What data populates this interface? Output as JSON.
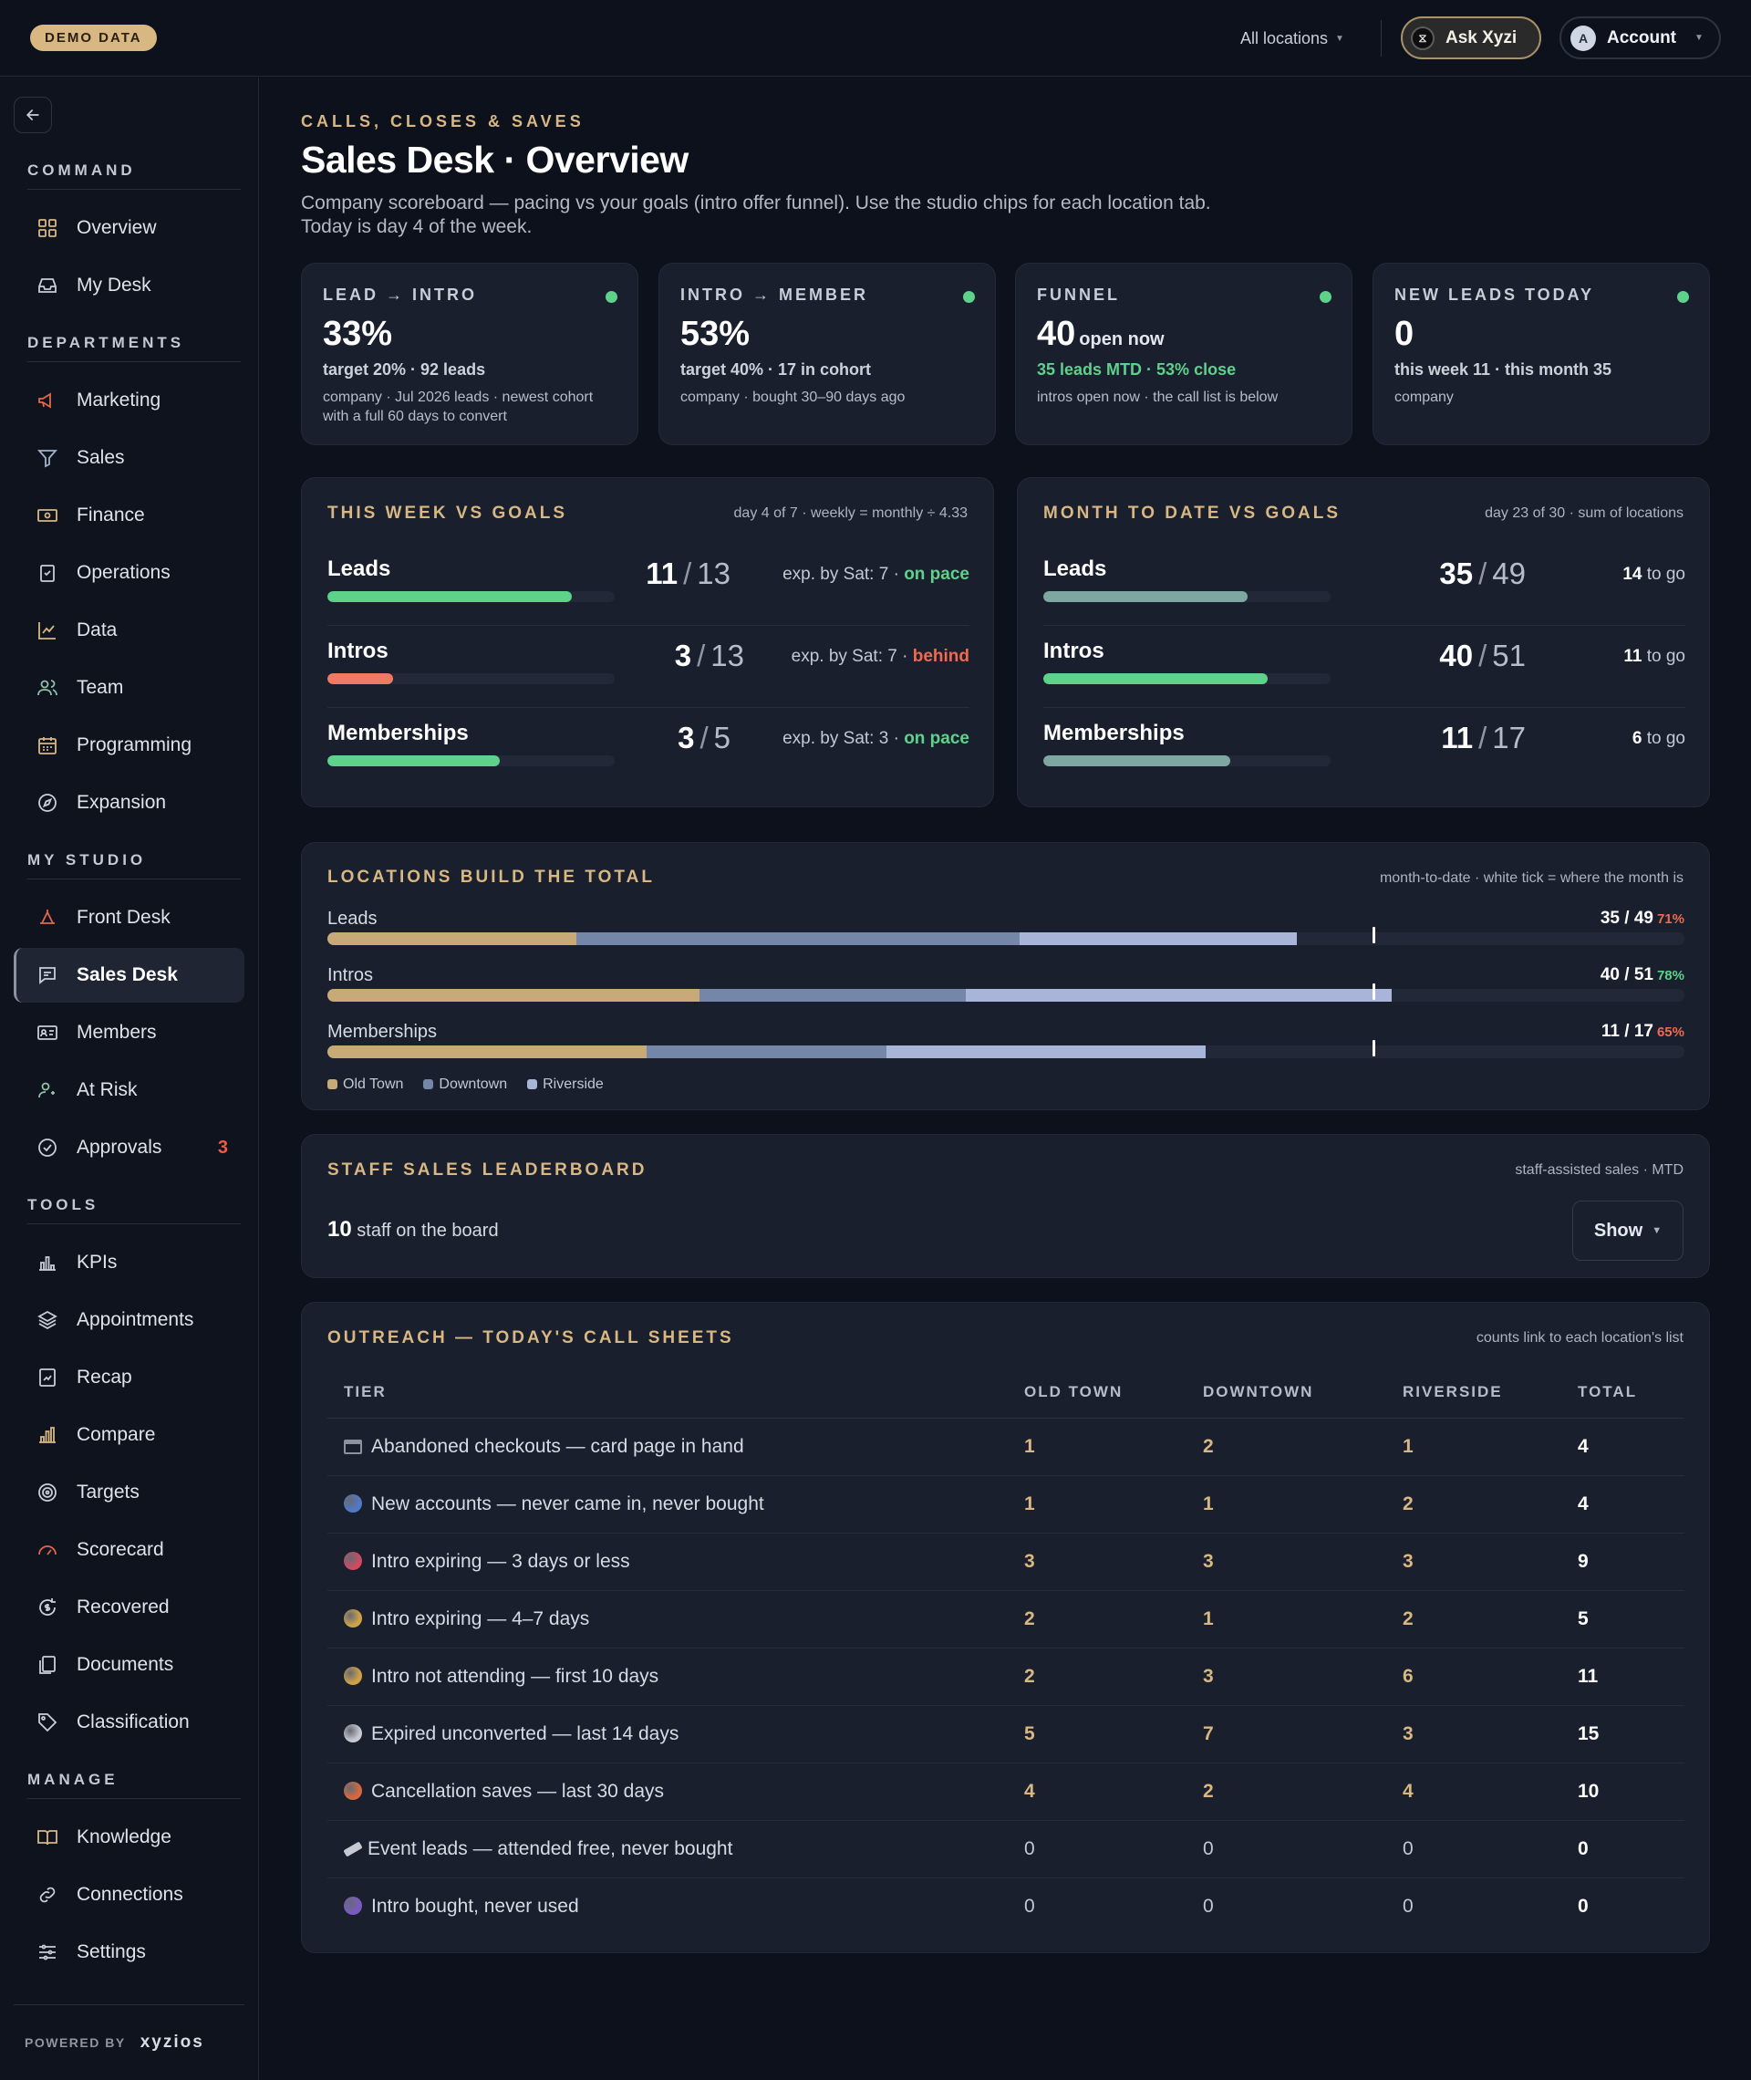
{
  "topbar": {
    "badge": "DEMO DATA",
    "locations": "All locations",
    "ask_label": "Ask Xyzi",
    "account_initial": "A",
    "account_label": "Account"
  },
  "sidebar": {
    "sections": {
      "command": "COMMAND",
      "departments": "DEPARTMENTS",
      "my_studio": "MY STUDIO",
      "tools": "TOOLS",
      "manage": "MANAGE"
    },
    "items": {
      "overview": "Overview",
      "my_desk": "My Desk",
      "marketing": "Marketing",
      "sales": "Sales",
      "finance": "Finance",
      "operations": "Operations",
      "data": "Data",
      "team": "Team",
      "programming": "Programming",
      "expansion": "Expansion",
      "front_desk": "Front Desk",
      "sales_desk": "Sales Desk",
      "members": "Members",
      "at_risk": "At Risk",
      "approvals": "Approvals",
      "kpis": "KPIs",
      "appointments": "Appointments",
      "recap": "Recap",
      "compare": "Compare",
      "targets": "Targets",
      "scorecard": "Scorecard",
      "recovered": "Recovered",
      "documents": "Documents",
      "classification": "Classification",
      "knowledge": "Knowledge",
      "connections": "Connections",
      "settings": "Settings"
    },
    "approvals_count": "3",
    "active_item": "Sales Desk",
    "footer": {
      "powered_by": "POWERED BY",
      "brand": "xyzios"
    }
  },
  "header": {
    "eyebrow": "CALLS, CLOSES & SAVES",
    "title": "Sales Desk · Overview",
    "description": "Company scoreboard — pacing vs your goals (intro offer funnel). Use the studio chips for each location tab. Today is day 4 of the week."
  },
  "kpis": [
    {
      "label": "LEAD → INTRO",
      "value": "33%",
      "unit": "",
      "line2": "target 20% · 92 leads",
      "line3": "company · Jul 2026 leads · newest cohort with a full 60 days to convert"
    },
    {
      "label": "INTRO → MEMBER",
      "value": "53%",
      "unit": "",
      "line2": "target 40% · 17 in cohort",
      "line3": "company · bought 30–90 days ago"
    },
    {
      "label": "FUNNEL",
      "value": "40",
      "unit": "open now",
      "line2": "35 leads MTD · 53% close",
      "line3": "intros open now · the call list is below"
    },
    {
      "label": "NEW LEADS TODAY",
      "value": "0",
      "unit": "",
      "line2": "this week 11 · this month 35",
      "line3": "company"
    }
  ],
  "week_goals": {
    "title": "THIS WEEK VS GOALS",
    "note": "day 4 of 7 · weekly = monthly ÷ 4.33",
    "rows": [
      {
        "name": "Leads",
        "actual": "11",
        "goal": "13",
        "exp": "exp. by Sat: 7 ·",
        "status": "on pace",
        "progress": 0.85
      },
      {
        "name": "Intros",
        "actual": "3",
        "goal": "13",
        "exp": "exp. by Sat: 7 ·",
        "status": "behind",
        "progress": 0.23
      },
      {
        "name": "Memberships",
        "actual": "3",
        "goal": "5",
        "exp": "exp. by Sat: 3 ·",
        "status": "on pace",
        "progress": 0.6
      }
    ]
  },
  "month_goals": {
    "title": "MONTH TO DATE VS GOALS",
    "note": "day 23 of 30 · sum of locations",
    "rows": [
      {
        "name": "Leads",
        "actual": "35",
        "goal": "49",
        "togo_num": "14",
        "togo_txt": "to go",
        "progress": 0.71
      },
      {
        "name": "Intros",
        "actual": "40",
        "goal": "51",
        "togo_num": "11",
        "togo_txt": "to go",
        "progress": 0.78
      },
      {
        "name": "Memberships",
        "actual": "11",
        "goal": "17",
        "togo_num": "6",
        "togo_txt": "to go",
        "progress": 0.65
      }
    ]
  },
  "locations": {
    "title": "LOCATIONS BUILD THE TOTAL",
    "note": "month-to-date · white tick = where the month is",
    "month_position": 0.77,
    "legend": [
      "Old Town",
      "Downtown",
      "Riverside"
    ],
    "colors": {
      "old_town": "#c8aa78",
      "downtown": "#7587a8",
      "riverside": "#a9b4d9"
    },
    "rows": [
      {
        "label": "Leads",
        "value": "35 / 49",
        "pct": "71%",
        "pct_color": "#f06a4f",
        "goal": 49,
        "parts": [
          9,
          16,
          10
        ]
      },
      {
        "label": "Intros",
        "value": "40 / 51",
        "pct": "78%",
        "pct_color": "#5ed18b",
        "goal": 51,
        "parts": [
          14,
          10,
          16
        ]
      },
      {
        "label": "Memberships",
        "value": "11 / 17",
        "pct": "65%",
        "pct_color": "#f06a4f",
        "goal": 17,
        "parts": [
          4,
          3,
          4
        ]
      }
    ]
  },
  "leaderboard": {
    "title": "STAFF SALES LEADERBOARD",
    "note": "staff-assisted sales · MTD",
    "count": "10",
    "count_label": "staff on the board",
    "show_label": "Show"
  },
  "outreach": {
    "title": "OUTREACH — TODAY'S CALL SHEETS",
    "note": "counts link to each location's list",
    "columns": [
      "TIER",
      "OLD TOWN",
      "DOWNTOWN",
      "RIVERSIDE",
      "TOTAL"
    ],
    "rows": [
      {
        "icon": "card-icon",
        "color": "#8b93a3",
        "tier": "Abandoned checkouts — card page in hand",
        "old_town": "1",
        "downtown": "2",
        "riverside": "1",
        "total": "4"
      },
      {
        "icon": "blue-dot-icon",
        "color": "#4f79c7",
        "tier": "New accounts — never came in, never bought",
        "old_town": "1",
        "downtown": "1",
        "riverside": "2",
        "total": "4"
      },
      {
        "icon": "red-dot-icon",
        "color": "#d04a60",
        "tier": "Intro expiring — 3 days or less",
        "old_town": "3",
        "downtown": "3",
        "riverside": "3",
        "total": "9"
      },
      {
        "icon": "yellow-dot-icon",
        "color": "#cfa245",
        "tier": "Intro expiring — 4–7 days",
        "old_town": "2",
        "downtown": "1",
        "riverside": "2",
        "total": "5"
      },
      {
        "icon": "yellow-dot-icon",
        "color": "#cfa245",
        "tier": "Intro not attending — first 10 days",
        "old_town": "2",
        "downtown": "3",
        "riverside": "6",
        "total": "11"
      },
      {
        "icon": "white-dot-icon",
        "color": "#c7c9d3",
        "tier": "Expired unconverted — last 14 days",
        "old_town": "5",
        "downtown": "7",
        "riverside": "3",
        "total": "15"
      },
      {
        "icon": "orange-dot-icon",
        "color": "#d9683f",
        "tier": "Cancellation saves — last 30 days",
        "old_town": "4",
        "downtown": "2",
        "riverside": "4",
        "total": "10"
      },
      {
        "icon": "ticket-icon",
        "color": "#c7c9d3",
        "tier": "Event leads — attended free, never bought",
        "old_town": "0",
        "downtown": "0",
        "riverside": "0",
        "total": "0"
      },
      {
        "icon": "purple-dot-icon",
        "color": "#7a5bc3",
        "tier": "Intro bought, never used",
        "old_town": "0",
        "downtown": "0",
        "riverside": "0",
        "total": "0"
      }
    ]
  }
}
